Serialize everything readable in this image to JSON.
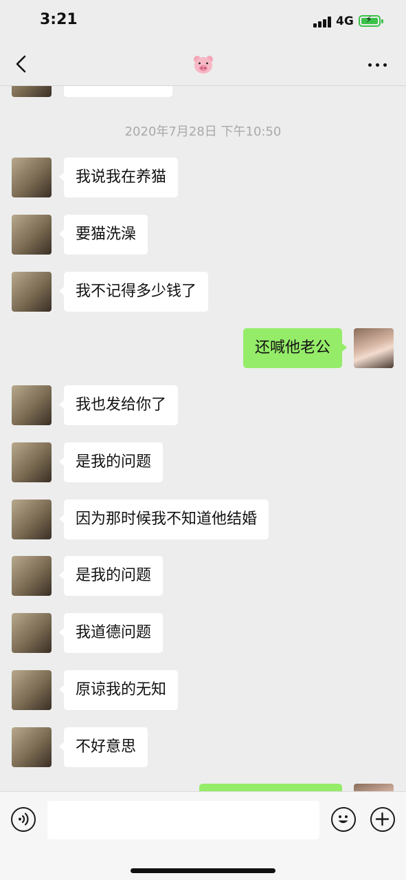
{
  "status_bar": {
    "time": "3:21",
    "network": "4G"
  },
  "nav": {
    "title_icon": "pig-face-emoji",
    "back_icon": "chevron-left-icon",
    "more_icon": "ellipsis-icon"
  },
  "chat": {
    "timestamp": "2020年7月28日 下午10:50",
    "messages": [
      {
        "side": "in",
        "text": "我说我在养猫"
      },
      {
        "side": "in",
        "text": "要猫洗澡"
      },
      {
        "side": "in",
        "text": "我不记得多少钱了"
      },
      {
        "side": "out",
        "text": "还喊他老公"
      },
      {
        "side": "in",
        "text": "我也发给你了"
      },
      {
        "side": "in",
        "text": "是我的问题"
      },
      {
        "side": "in",
        "text": "因为那时候我不知道他结婚"
      },
      {
        "side": "in",
        "text": "是我的问题"
      },
      {
        "side": "in",
        "text": "我道德问题"
      },
      {
        "side": "in",
        "text": "原谅我的无知"
      },
      {
        "side": "in",
        "text": "不好意思"
      }
    ]
  },
  "input_bar": {
    "voice_icon": "voice-icon",
    "emoji_icon": "smiley-icon",
    "add_icon": "plus-circle-icon",
    "input_value": ""
  },
  "colors": {
    "background": "#ededed",
    "outgoing_bubble": "#95ec69",
    "incoming_bubble": "#ffffff",
    "battery": "#3bc24a"
  }
}
